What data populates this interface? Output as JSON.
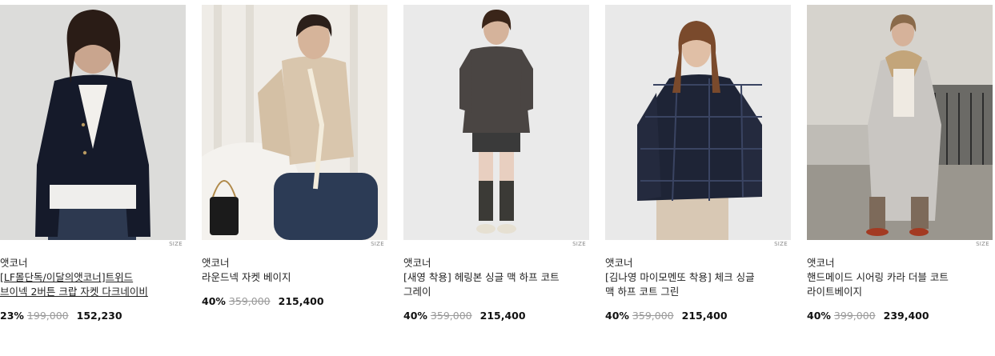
{
  "size_label": "SIZE",
  "products": [
    {
      "brand": "앳코너",
      "title": "[LF몰단독/이달의앳코너]트위드 브이넥 2버튼 크랍 자켓 다크네이비",
      "discount": "23%",
      "original_price": "199,000",
      "sale_price": "152,230"
    },
    {
      "brand": "앳코너",
      "title": "라운드넥 자켓 베이지",
      "discount": "40%",
      "original_price": "359,000",
      "sale_price": "215,400"
    },
    {
      "brand": "앳코너",
      "title": "[새영 착용] 헤링본 싱글 맥 하프 코트 그레이",
      "discount": "40%",
      "original_price": "359,000",
      "sale_price": "215,400"
    },
    {
      "brand": "앳코너",
      "title": "[김나영 마이모멘또 착용] 체크 싱글 맥 하프 코트 그린",
      "discount": "40%",
      "original_price": "359,000",
      "sale_price": "215,400"
    },
    {
      "brand": "앳코너",
      "title": "핸드메이드 시어링 카라 더블 코트 라이트베이지",
      "discount": "40%",
      "original_price": "399,000",
      "sale_price": "239,400"
    }
  ]
}
